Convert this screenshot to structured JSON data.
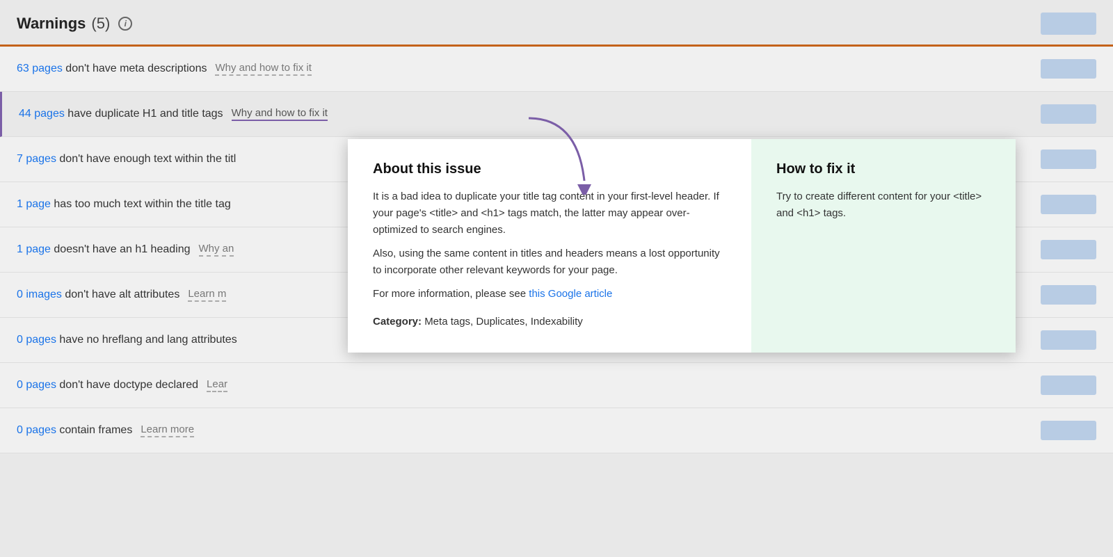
{
  "header": {
    "title": "Warnings",
    "count_label": "(5)",
    "info_icon": "i",
    "btn_label": ""
  },
  "rows": [
    {
      "id": "row-meta-desc",
      "link_text": "63 pages",
      "description": " don't have meta descriptions",
      "why_fix_label": "Why and how to fix it",
      "has_why_fix": true,
      "highlighted": false
    },
    {
      "id": "row-duplicate-h1",
      "link_text": "44 pages",
      "description": " have duplicate H1 and title tags",
      "why_fix_label": "Why and how to fix it",
      "has_why_fix": true,
      "highlighted": true
    },
    {
      "id": "row-not-enough-text",
      "link_text": "7 pages",
      "description": " don't have enough text within the titl",
      "why_fix_label": "",
      "has_why_fix": false,
      "highlighted": false
    },
    {
      "id": "row-too-much-text",
      "link_text": "1 page",
      "description": " has too much text within the title tag",
      "why_fix_label": "",
      "has_why_fix": false,
      "highlighted": false
    },
    {
      "id": "row-no-h1",
      "link_text": "1 page",
      "description": " doesn't have an h1 heading",
      "why_fix_label": "Why an",
      "has_why_fix": true,
      "highlighted": false,
      "truncated": true
    },
    {
      "id": "row-no-alt",
      "link_text": "0 images",
      "description": " don't have alt attributes",
      "why_fix_label": "Learn m",
      "has_why_fix": true,
      "highlighted": false,
      "truncated": true
    },
    {
      "id": "row-hreflang",
      "link_text": "0 pages",
      "description": " have no hreflang and lang attributes",
      "why_fix_label": "",
      "has_why_fix": false,
      "highlighted": false
    },
    {
      "id": "row-doctype",
      "link_text": "0 pages",
      "description": " don't have doctype declared",
      "why_fix_label": "Lear",
      "has_why_fix": true,
      "highlighted": false,
      "truncated": true
    },
    {
      "id": "row-frames",
      "link_text": "0 pages",
      "description": " contain frames",
      "why_fix_label": "Learn more",
      "has_why_fix": true,
      "highlighted": false
    }
  ],
  "popup": {
    "left_title": "About this issue",
    "left_paragraphs": [
      "It is a bad idea to duplicate your title tag content in your first-level header. If your page's <title> and <h1> tags match, the latter may appear over-optimized to search engines.",
      "Also, using the same content in titles and headers means a lost opportunity to incorporate other relevant keywords for your page."
    ],
    "left_link_prefix": "For more information, please see ",
    "left_link_text": "this Google article",
    "category_label": "Category:",
    "category_value": " Meta tags, Duplicates, Indexability",
    "right_title": "How to fix it",
    "right_text": "Try to create different content for your <title> and <h1> tags."
  },
  "arrow": {
    "color": "#7b5ea7"
  }
}
